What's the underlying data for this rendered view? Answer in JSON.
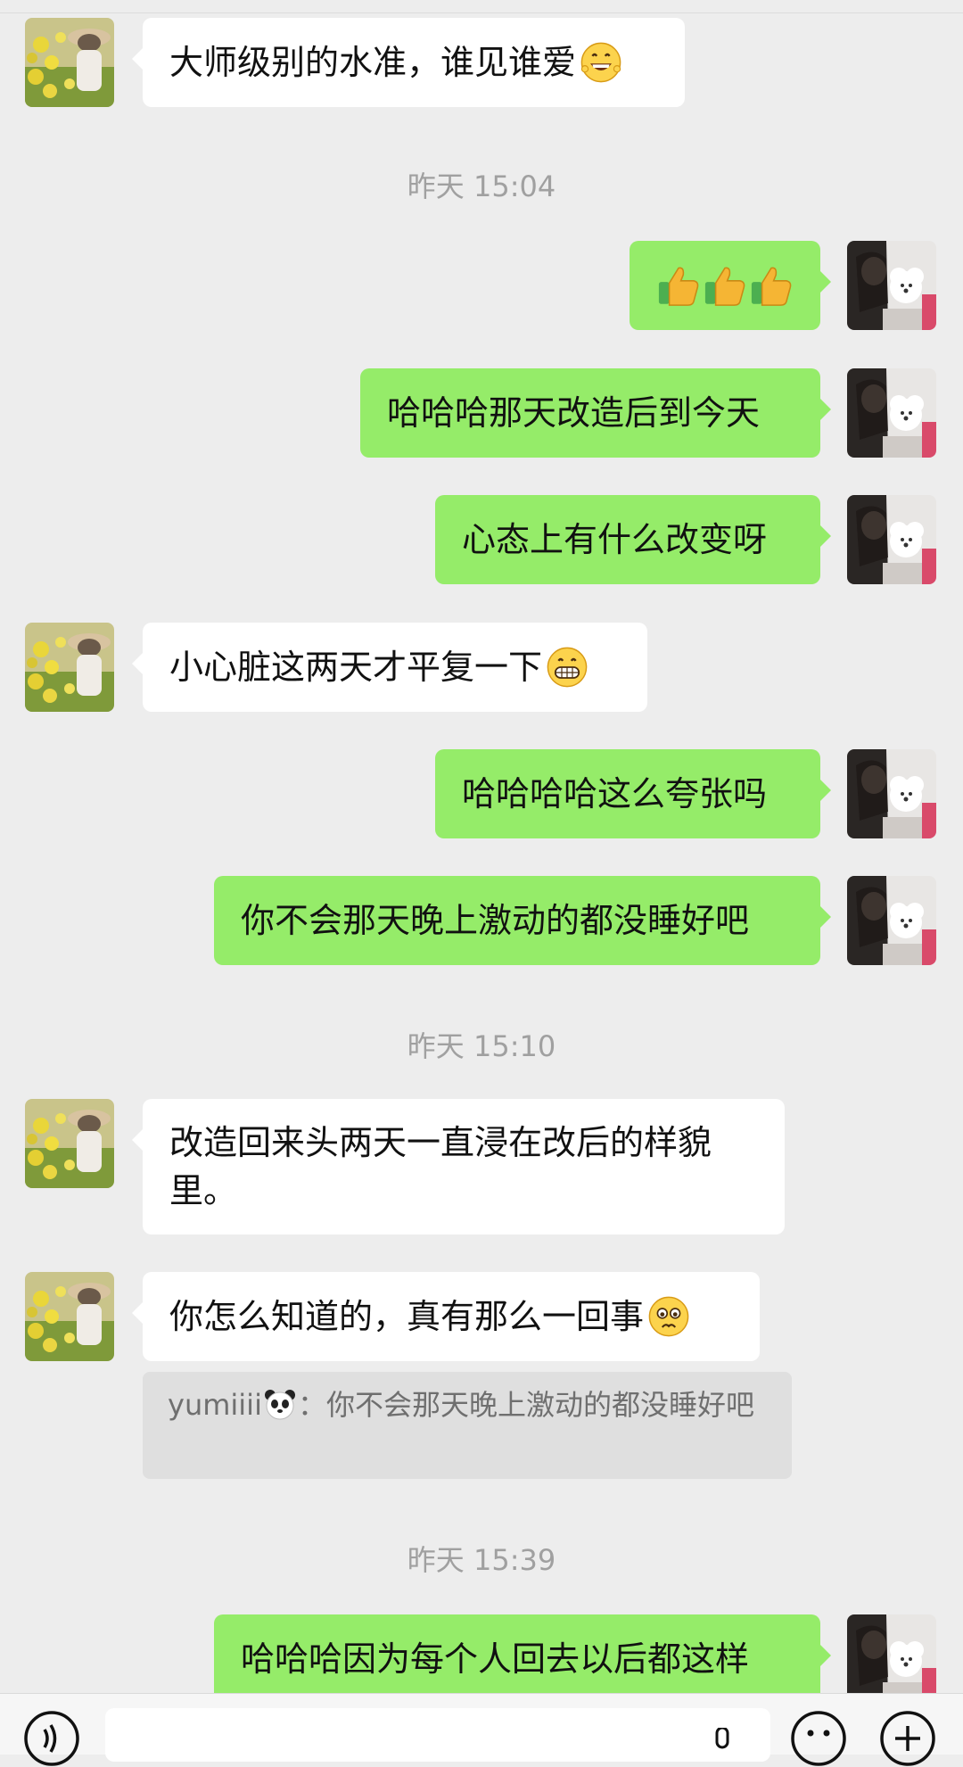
{
  "messages": {
    "m1": {
      "text": "大师级别的水准，谁见谁爱",
      "emoji": "grinning-face-emoji"
    },
    "t1": "昨天 15:04",
    "m2": {
      "emoji": "thumbs-up-emoji"
    },
    "m3": {
      "text": "哈哈哈那天改造后到今天"
    },
    "m4": {
      "text": "心态上有什么改变呀"
    },
    "m5": {
      "text": "小心脏这两天才平复一下",
      "emoji": "grimacing-face-emoji"
    },
    "m6": {
      "text": "哈哈哈哈这么夸张吗"
    },
    "m7": {
      "text": "你不会那天晚上激动的都没睡好吧"
    },
    "t2": "昨天 15:10",
    "m8": {
      "text": "改造回来头两天一直浸在改后的样貌里。"
    },
    "m9": {
      "text": "你怎么知道的，真有那么一回事",
      "emoji": "pleading-face-emoji"
    },
    "quote": {
      "name": "yumiiii",
      "name_emoji": "panda-emoji",
      "text": "：你不会那天晚上激动的都没睡好吧"
    },
    "t3": "昨天 15:39",
    "m10": {
      "text": "哈哈哈因为每个人回去以后都这样"
    }
  },
  "bottom_bar": {
    "voice_icon": "voice-icon",
    "mic_icon": "microphone-icon",
    "emoji_icon": "emoji-button-icon",
    "add_icon": "plus-icon"
  },
  "colors": {
    "background": "#ededed",
    "incoming_bubble": "#ffffff",
    "outgoing_bubble": "#95ec69",
    "timestamp": "#a0a0a0"
  }
}
